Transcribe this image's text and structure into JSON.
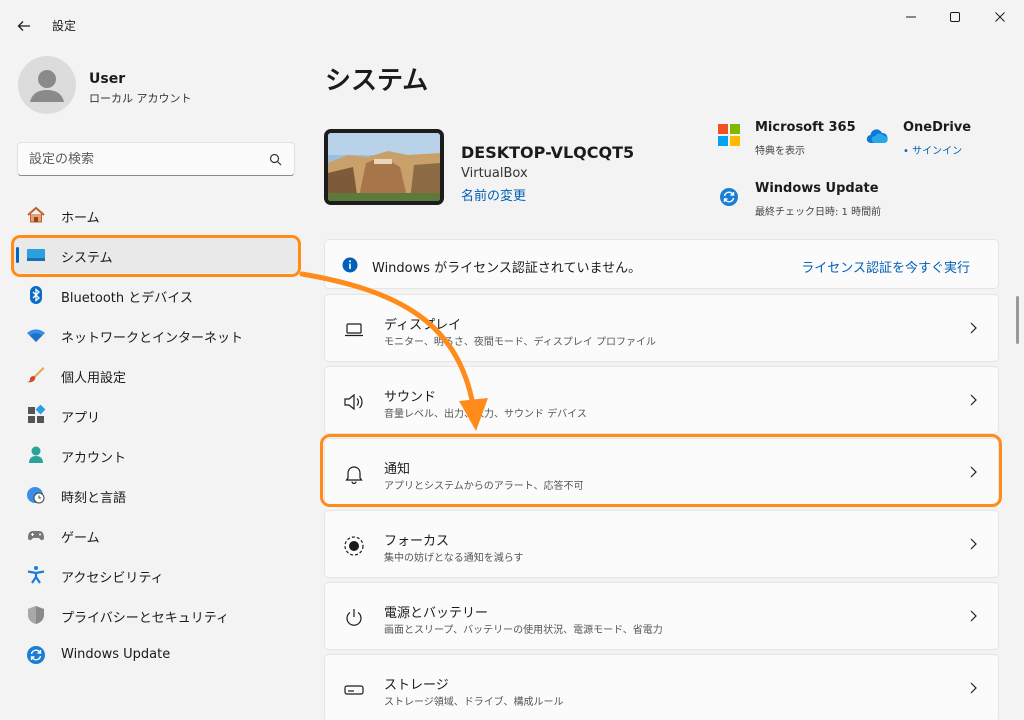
{
  "window": {
    "title": "設定"
  },
  "profile": {
    "name": "User",
    "account_type": "ローカル アカウント"
  },
  "search": {
    "placeholder": "設定の検索"
  },
  "sidebar": {
    "items": [
      {
        "label": "ホーム",
        "icon": "home-icon"
      },
      {
        "label": "システム",
        "icon": "system-icon",
        "active": true
      },
      {
        "label": "Bluetooth とデバイス",
        "icon": "bluetooth-icon"
      },
      {
        "label": "ネットワークとインターネット",
        "icon": "network-icon"
      },
      {
        "label": "個人用設定",
        "icon": "brush-icon"
      },
      {
        "label": "アプリ",
        "icon": "apps-icon"
      },
      {
        "label": "アカウント",
        "icon": "account-icon"
      },
      {
        "label": "時刻と言語",
        "icon": "globe-clock-icon"
      },
      {
        "label": "ゲーム",
        "icon": "gamepad-icon"
      },
      {
        "label": "アクセシビリティ",
        "icon": "accessibility-icon"
      },
      {
        "label": "プライバシーとセキュリティ",
        "icon": "shield-icon"
      },
      {
        "label": "Windows Update",
        "icon": "update-icon"
      }
    ]
  },
  "main": {
    "title": "システム",
    "device": {
      "name": "DESKTOP-VLQCQT5",
      "model": "VirtualBox",
      "rename": "名前の変更"
    },
    "services": {
      "ms365": {
        "title": "Microsoft 365",
        "sub": "特典を表示"
      },
      "onedrive": {
        "title": "OneDrive",
        "sub": "• サインイン"
      },
      "update": {
        "title": "Windows Update",
        "sub": "最終チェック日時: 1 時間前"
      }
    },
    "license": {
      "text": "Windows がライセンス認証されていません。",
      "action": "ライセンス認証を今すぐ実行"
    },
    "settings": [
      {
        "title": "ディスプレイ",
        "sub": "モニター、明るさ、夜間モード、ディスプレイ プロファイル",
        "icon": "display-icon"
      },
      {
        "title": "サウンド",
        "sub": "音量レベル、出力、入力、サウンド デバイス",
        "icon": "speaker-icon"
      },
      {
        "title": "通知",
        "sub": "アプリとシステムからのアラート、応答不可",
        "icon": "bell-icon"
      },
      {
        "title": "フォーカス",
        "sub": "集中の妨げとなる通知を減らす",
        "icon": "focus-icon"
      },
      {
        "title": "電源とバッテリー",
        "sub": "画面とスリープ、バッテリーの使用状況、電源モード、省電力",
        "icon": "power-icon"
      },
      {
        "title": "ストレージ",
        "sub": "ストレージ領域、ドライブ、構成ルール",
        "icon": "storage-icon"
      }
    ]
  },
  "colors": {
    "accent": "#0067c0",
    "link": "#005fb8",
    "highlight": "#ff8c1a"
  }
}
